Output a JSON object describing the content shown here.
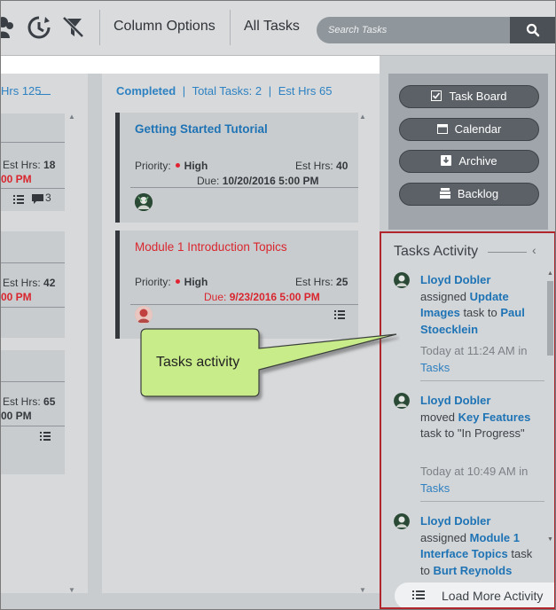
{
  "toolbar": {
    "icons": [
      "users-icon",
      "clock-refresh-icon",
      "filter-clear-icon"
    ],
    "column_options": "Column Options",
    "all_tasks": "All Tasks",
    "search_placeholder": "Search Tasks",
    "search_icon": "search-icon"
  },
  "left_column": {
    "header_partial": "Hrs 125",
    "cards": [
      {
        "est_label": "Est Hrs:",
        "est_value": "18",
        "due_partial": "00 PM",
        "comments": "3"
      },
      {
        "est_label": "Est Hrs:",
        "est_value": "42",
        "due_partial": "00 PM"
      },
      {
        "est_label": "Est Hrs:",
        "est_value": "65",
        "due_partial": "00 PM"
      }
    ]
  },
  "completed_column": {
    "name": "Completed",
    "total_tasks": "Total Tasks: 2",
    "est_hrs": "Est Hrs 65",
    "cards": [
      {
        "title": "Getting Started Tutorial",
        "title_color": "#1e73b5",
        "priority_label": "Priority:",
        "priority": "High",
        "est_label": "Est Hrs:",
        "est_value": "40",
        "due_label": "Due:",
        "due_value": "10/20/2016 5:00 PM",
        "overdue": false
      },
      {
        "title": "Module 1 Introduction Topics",
        "title_color": "#d9262e",
        "priority_label": "Priority:",
        "priority": "High",
        "est_label": "Est Hrs:",
        "est_value": "25",
        "due_label": "Due:",
        "due_value": "9/23/2016 5:00 PM",
        "overdue": true
      }
    ]
  },
  "nav": {
    "task_board": "Task Board",
    "calendar": "Calendar",
    "archive": "Archive",
    "backlog": "Backlog"
  },
  "activity": {
    "title": "Tasks Activity",
    "items": [
      {
        "user": "Lloyd Dobler",
        "verb": "assigned",
        "task": "Update Images",
        "mid": "task to",
        "target": "Paul Stoecklein",
        "time": "Today at 11:24 AM in",
        "board": "Tasks"
      },
      {
        "user": "Lloyd Dobler",
        "verb": "moved",
        "task": "Key Features",
        "mid": "task to \"In Progress\"",
        "time": "Today at 10:49 AM in",
        "board": "Tasks"
      },
      {
        "user": "Lloyd Dobler",
        "verb": "assigned",
        "task": "Module 1 Interface Topics",
        "mid": "task to",
        "target": "Burt Reynolds"
      }
    ],
    "load_more": "Load More Activity"
  },
  "callout": {
    "text": "Tasks activity",
    "fill_color": "#c8ec8a"
  },
  "colors": {
    "accent_blue": "#1e73b5",
    "overdue_red": "#d9262e",
    "activity_border": "#b0262c"
  }
}
